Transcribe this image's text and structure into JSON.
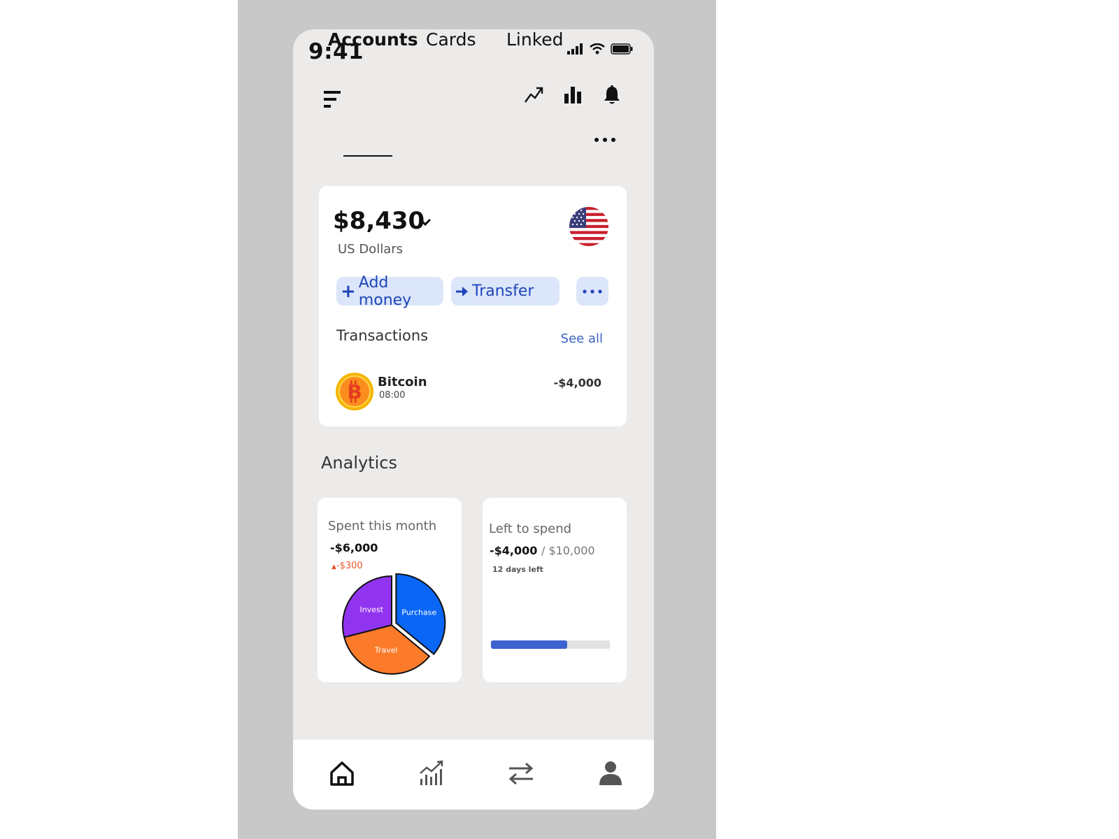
{
  "status_bar": {
    "time": "9:41",
    "icons": [
      "signal-icon",
      "wifi-icon",
      "battery-icon"
    ]
  },
  "header": {
    "menu_icon": "hamburger-icon",
    "actions": [
      "trend-icon",
      "bar-chart-icon",
      "bell-icon"
    ]
  },
  "tabs": [
    {
      "label": "Accounts",
      "active": true
    },
    {
      "label": "Cards",
      "active": false
    },
    {
      "label": "Linked",
      "active": false
    }
  ],
  "account": {
    "balance": "$8,430",
    "currency": "US Dollars",
    "flag": "us-flag",
    "actions": {
      "add_money": "Add money",
      "transfer": "Transfer"
    }
  },
  "transactions": {
    "heading": "Transactions",
    "see_all": "See all",
    "items": [
      {
        "name": "Bitcoin",
        "time": "08:00",
        "amount": "-$4,000",
        "icon": "bitcoin-icon"
      }
    ]
  },
  "analytics": {
    "title": "Analytics",
    "spent": {
      "label": "Spent this month",
      "value": "-$6,000",
      "delta": "-$300",
      "breakdown": [
        {
          "name": "Purchase",
          "color": "#0a66f5",
          "share": 0.36
        },
        {
          "name": "Travel",
          "color": "#fb7b2a",
          "share": 0.35
        },
        {
          "name": "Invest",
          "color": "#9134f0",
          "share": 0.29
        }
      ]
    },
    "left": {
      "label": "Left to spend",
      "spent": "-$4,000",
      "total": "/ $10,000",
      "days_left": "12 days left",
      "progress": 0.64
    }
  },
  "bottom_nav": [
    "home-icon",
    "analytics-icon",
    "transfer-icon",
    "profile-icon"
  ],
  "colors": {
    "accent": "#1f45b8",
    "pill_bg": "#dbe6fa",
    "progress": "#3c63cf",
    "delta": "#e8542a"
  }
}
